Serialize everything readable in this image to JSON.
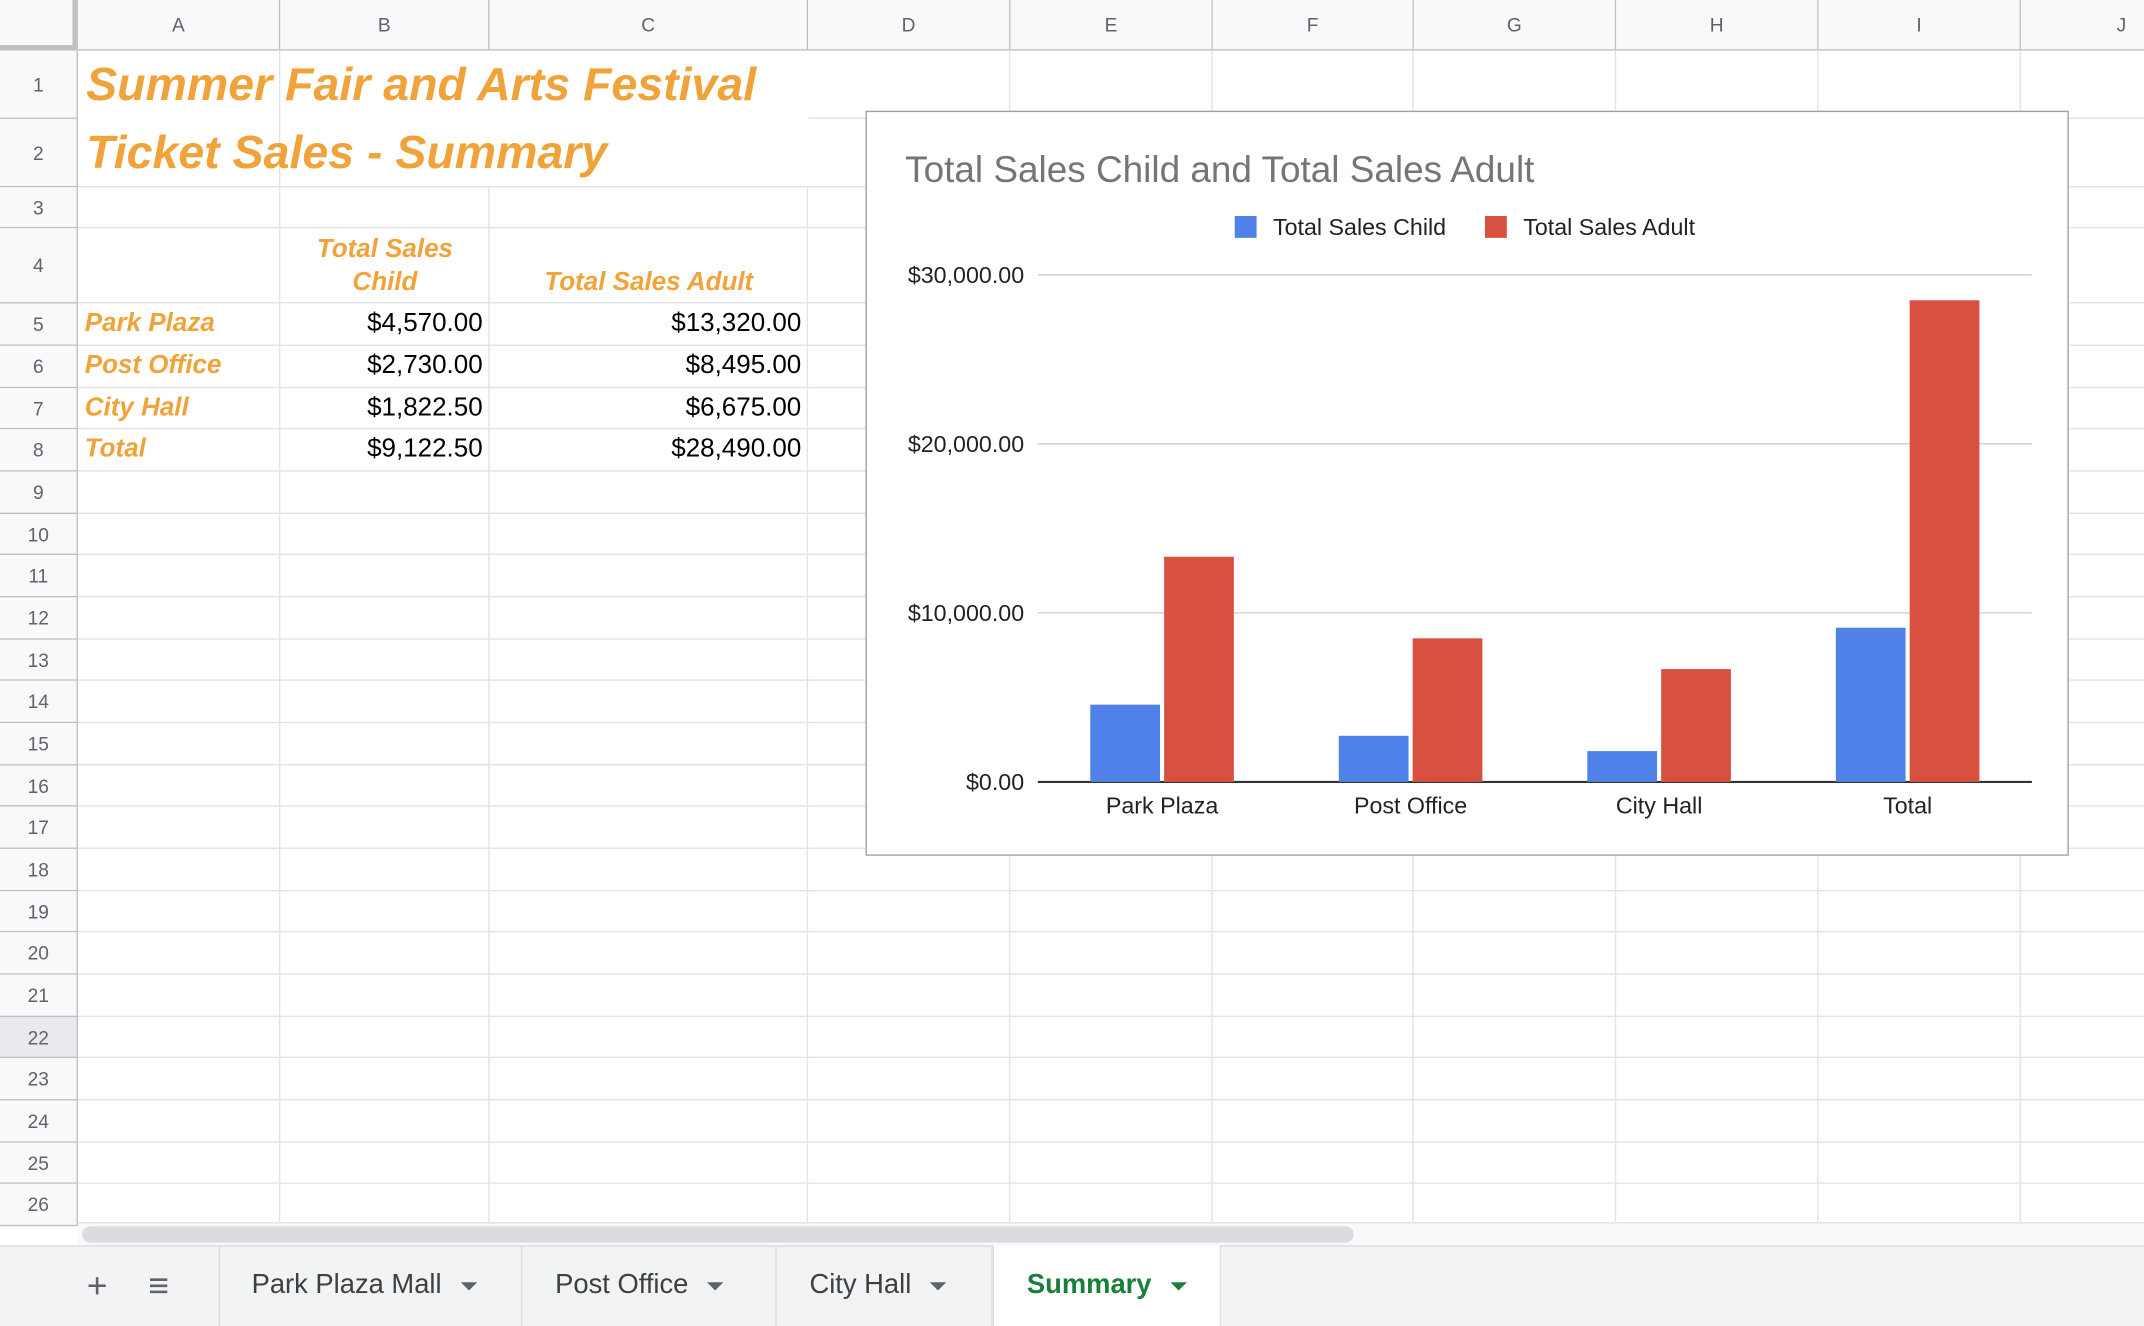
{
  "columns": [
    "A",
    "B",
    "C",
    "D",
    "E",
    "F",
    "G",
    "H",
    "I",
    "J"
  ],
  "rows": [
    "1",
    "2",
    "3",
    "4",
    "5",
    "6",
    "7",
    "8",
    "9",
    "10",
    "11",
    "12",
    "13",
    "14",
    "15",
    "16",
    "17",
    "18",
    "19",
    "20",
    "21",
    "22",
    "23",
    "24",
    "25",
    "26"
  ],
  "sheet": {
    "title_line1": "Summer Fair and Arts Festival",
    "title_line2": "Ticket Sales - Summary",
    "header_child_line1": "Total Sales",
    "header_child_line2": "Child",
    "header_adult": "Total Sales Adult",
    "data_rows": [
      {
        "label": "Park Plaza",
        "child": "$4,570.00",
        "adult": "$13,320.00"
      },
      {
        "label": "Post Office",
        "child": "$2,730.00",
        "adult": "$8,495.00"
      },
      {
        "label": "City Hall",
        "child": "$1,822.50",
        "adult": "$6,675.00"
      },
      {
        "label": "Total",
        "child": "$9,122.50",
        "adult": "$28,490.00"
      }
    ]
  },
  "chart_data": {
    "type": "bar",
    "title": "Total Sales Child and Total Sales Adult",
    "categories": [
      "Park Plaza",
      "Post Office",
      "City Hall",
      "Total"
    ],
    "series": [
      {
        "name": "Total Sales Child",
        "values": [
          4570,
          2730,
          1822.5,
          9122.5
        ],
        "color": "#4f81e8"
      },
      {
        "name": "Total Sales Adult",
        "values": [
          13320,
          8495,
          6675,
          28490
        ],
        "color": "#d8503f"
      }
    ],
    "ylim": [
      0,
      30000
    ],
    "yticks": [
      0,
      10000,
      20000,
      30000
    ],
    "ytick_labels": [
      "$0.00",
      "$10,000.00",
      "$20,000.00",
      "$30,000.00"
    ],
    "legend_position": "top",
    "gridlines": true
  },
  "tabs": [
    {
      "label": "Park Plaza Mall"
    },
    {
      "label": "Post Office"
    },
    {
      "label": "City Hall"
    },
    {
      "label": "Summary"
    }
  ],
  "toolbar": {
    "add_sheet_symbol": "+",
    "all_sheets_symbol": "≡"
  },
  "icons": {
    "add_sheet": "plus-icon",
    "all_sheets": "menu-icon",
    "tab_caret": "caret-down-icon"
  },
  "colors": {
    "accent_orange": "#f1a33b",
    "active_tab_green": "#188038"
  }
}
